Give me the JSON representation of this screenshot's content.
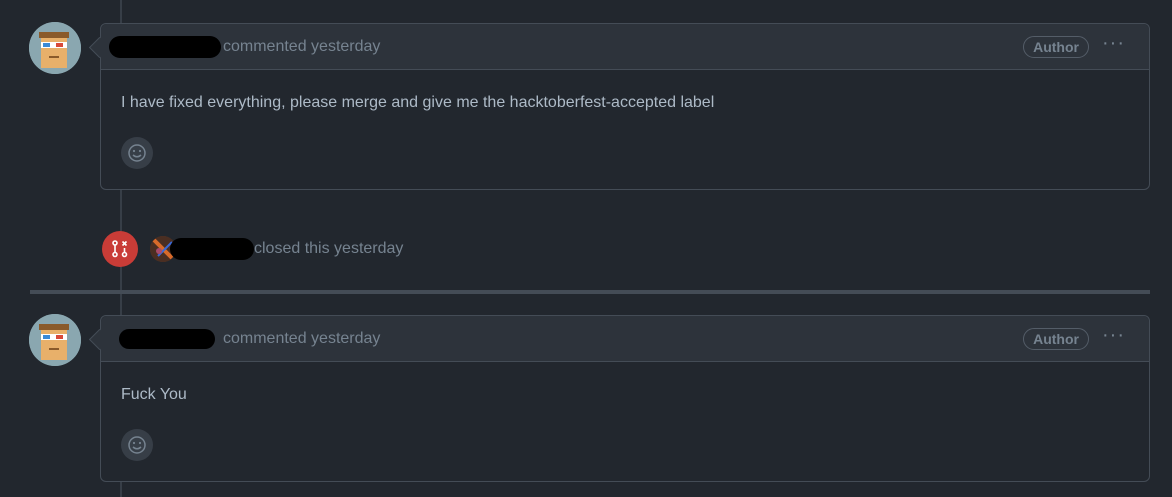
{
  "comments": [
    {
      "meta": "commented yesterday",
      "badge": "Author",
      "body": "I have fixed everything, please merge and give me the hacktoberfest-accepted label"
    },
    {
      "meta": "commented yesterday",
      "badge": "Author",
      "body": "Fuck You"
    }
  ],
  "closed_event": {
    "text": "closed this yesterday"
  },
  "colors": {
    "background": "#22272e",
    "header": "#2d333b",
    "border": "#444c56",
    "closed": "#c93c37"
  },
  "icons": {
    "more": "kebab-horizontal-icon",
    "reaction": "smiley-icon",
    "closed": "git-pull-request-closed-icon"
  }
}
